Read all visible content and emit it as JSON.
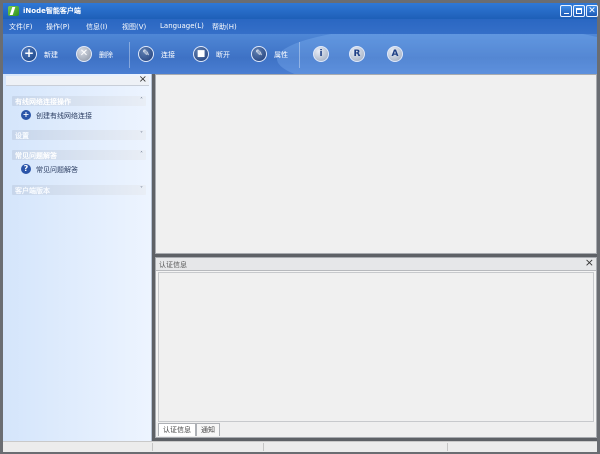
{
  "window": {
    "title": "iNode智能客户端",
    "controls": {
      "minimize": "",
      "maximize": "",
      "close": "✕"
    }
  },
  "menu": [
    "文件(F)",
    "操作(P)",
    "信息(I)",
    "视图(V)",
    "Language(L)",
    "帮助(H)"
  ],
  "toolbar": {
    "new": {
      "label": "新建",
      "icon": "plus-icon"
    },
    "delete": {
      "label": "删除",
      "icon": "x-circle-icon"
    },
    "connect": {
      "label": "连接",
      "icon": "pen-icon"
    },
    "disconnect": {
      "label": "断开",
      "icon": "stop-icon"
    },
    "properties": {
      "label": "属性",
      "icon": "wrench-icon"
    },
    "info_glyph": "i",
    "r_glyph": "R",
    "a_glyph": "A"
  },
  "left": {
    "close": "×",
    "sections": [
      {
        "label": "有线网络连接操作",
        "chevron": "˄"
      },
      {
        "label": "设置",
        "chevron": "˅"
      },
      {
        "label": "常见问题解答",
        "chevron": "˄"
      },
      {
        "label": "客户端版本",
        "chevron": "˅"
      }
    ],
    "links": [
      {
        "label": "创建有线网络连接",
        "glyph": "+"
      },
      {
        "label": "常见问题解答",
        "glyph": "?"
      }
    ]
  },
  "auth": {
    "title": "认证信息",
    "close": "×",
    "tabs": [
      "认证信息",
      "通知"
    ]
  },
  "colors": {
    "titlebar": "#2f78d6",
    "toolbar": "#3e72c5",
    "left": "#d4e5fb"
  }
}
